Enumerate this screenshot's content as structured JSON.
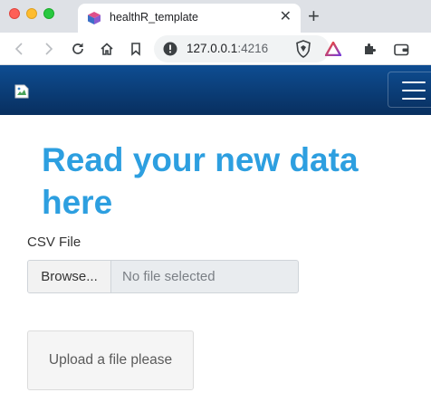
{
  "browser": {
    "window_controls": [
      "close",
      "minimize",
      "zoom"
    ],
    "tab": {
      "title": "healthR_template",
      "favicon": "cube-icon",
      "close_glyph": "✕"
    },
    "new_tab_glyph": "+",
    "toolbar": {
      "url_host": "127.0.0.1",
      "url_port": ":4216",
      "icons": [
        "back-icon",
        "forward-icon",
        "reload-icon",
        "home-icon",
        "bookmark-icon",
        "info-icon",
        "brave-shield-icon",
        "brave-rewards-icon",
        "extensions-icon",
        "wallet-icon"
      ]
    }
  },
  "navbar": {
    "background": "#0e4d92",
    "brand": "broken-image-icon",
    "toggle": "hamburger-icon"
  },
  "main": {
    "heading_line1": "Read your new data",
    "heading_line2": "here",
    "heading_color": "#2d9fe0",
    "file_input": {
      "label": "CSV File",
      "browse_label": "Browse...",
      "placeholder": "No file selected"
    },
    "output_message": "Upload a file please"
  }
}
